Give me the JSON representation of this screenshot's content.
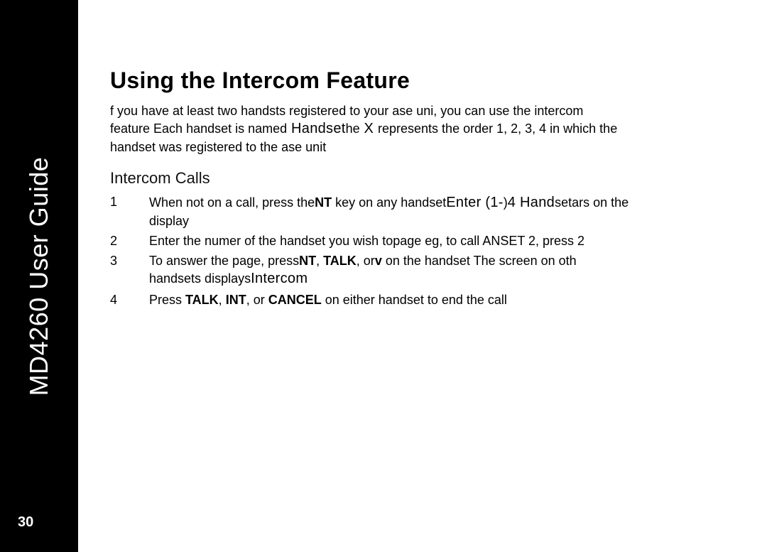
{
  "sidebar": {
    "title": "MD4260 User Guide",
    "page_number": "30"
  },
  "main": {
    "section_title": "Using the Intercom Feature",
    "intro_line1_a": "f you have at least two hands",
    "intro_line1_b": "ts registered to your ase uni",
    "intro_line1_c": ", you can use the intercom",
    "intro_line2_a": "feature Each handset is named",
    "intro_line2_handset": " Handset",
    "intro_line2_b": "he",
    "intro_line2_x": " X ",
    "intro_line2_c": " represents the order 1, 2, 3, 4 in which the",
    "intro_line3": "handset was registered to the ase unit",
    "subhead": "Intercom Calls",
    "steps": [
      {
        "num": "1",
        "a": "When not on a call, press the",
        "key1": "NT",
        "b": " key on any handset",
        "disp": "Enter (1-",
        "c": ")",
        "disp2": "4 Hand",
        "d": "set",
        "e": "ars on the",
        "f": "display"
      },
      {
        "num": "2",
        "a": "Enter the numer of the handset you wish to",
        "b": "page eg, to call ANSET 2, press 2"
      },
      {
        "num": "3",
        "a": "To answer the page, press",
        "key1": "NT",
        "comma1": ", ",
        "key2": "TALK",
        "comma2": ", or",
        "key3": "v",
        "b": "    on the handset The screen on oth",
        "c": "handsets displays",
        "disp": "Intercom"
      },
      {
        "num": "4",
        "a": "Press ",
        "key1": "TALK",
        "comma1": ", ",
        "key2": "INT",
        "comma2": ", or",
        "key3": "CANCEL",
        "b": " on either handset to end the call"
      }
    ]
  }
}
